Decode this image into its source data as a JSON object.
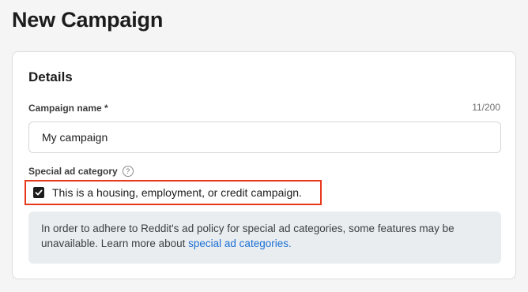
{
  "page": {
    "title": "New Campaign"
  },
  "details": {
    "section_title": "Details",
    "campaign_name": {
      "label": "Campaign name *",
      "char_count": "11/200",
      "value": "My campaign"
    },
    "special_ad_category": {
      "label": "Special ad category",
      "help_icon": "question-circle-icon",
      "checkbox_label": "This is a housing, employment, or credit campaign.",
      "checked": true,
      "highlight_color": "#e8381c"
    },
    "info": {
      "text": "In order to adhere to Reddit's ad policy for special ad categories, some features may be unavailable. Learn more about ",
      "link_text": "special ad categories.",
      "link_color": "#1a6fd6"
    }
  }
}
